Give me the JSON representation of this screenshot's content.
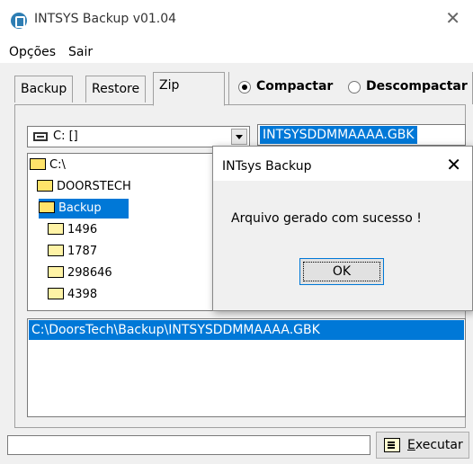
{
  "window": {
    "title": "INTSYS Backup v01.04",
    "close_label": "✕"
  },
  "menu": {
    "items": [
      "Opções",
      "Sair"
    ]
  },
  "tabs": [
    {
      "label": "Backup"
    },
    {
      "label": "Restore"
    },
    {
      "label": "Zip",
      "active": true
    }
  ],
  "mode": {
    "options": [
      {
        "label": "Compactar",
        "selected": true
      },
      {
        "label": "Descompactar",
        "selected": false
      }
    ]
  },
  "drive": {
    "value": "C: []"
  },
  "file_name": {
    "value": "INTSYSDDMMAAAA.GBK"
  },
  "directories": [
    {
      "name": "C:\\",
      "level": 0,
      "open": true
    },
    {
      "name": "DOORSTECH",
      "level": 1,
      "open": true
    },
    {
      "name": "Backup",
      "level": 1,
      "open": true,
      "selected": true
    },
    {
      "name": "1496",
      "level": 2
    },
    {
      "name": "1787",
      "level": 2
    },
    {
      "name": "298646",
      "level": 2
    },
    {
      "name": "4398",
      "level": 2
    }
  ],
  "output_path": "C:\\DoorsTech\\Backup\\INTSYSDDMMAAAA.GBK",
  "progress": {
    "fraction": 0.0
  },
  "execute_button": {
    "label": "Executar"
  },
  "dialog": {
    "title": "INTsys Backup",
    "message": "Arquivo gerado com sucesso !",
    "ok_label": "OK",
    "close_label": "✕"
  },
  "colors": {
    "selection": "#0078d7",
    "progress": "#06b025"
  }
}
